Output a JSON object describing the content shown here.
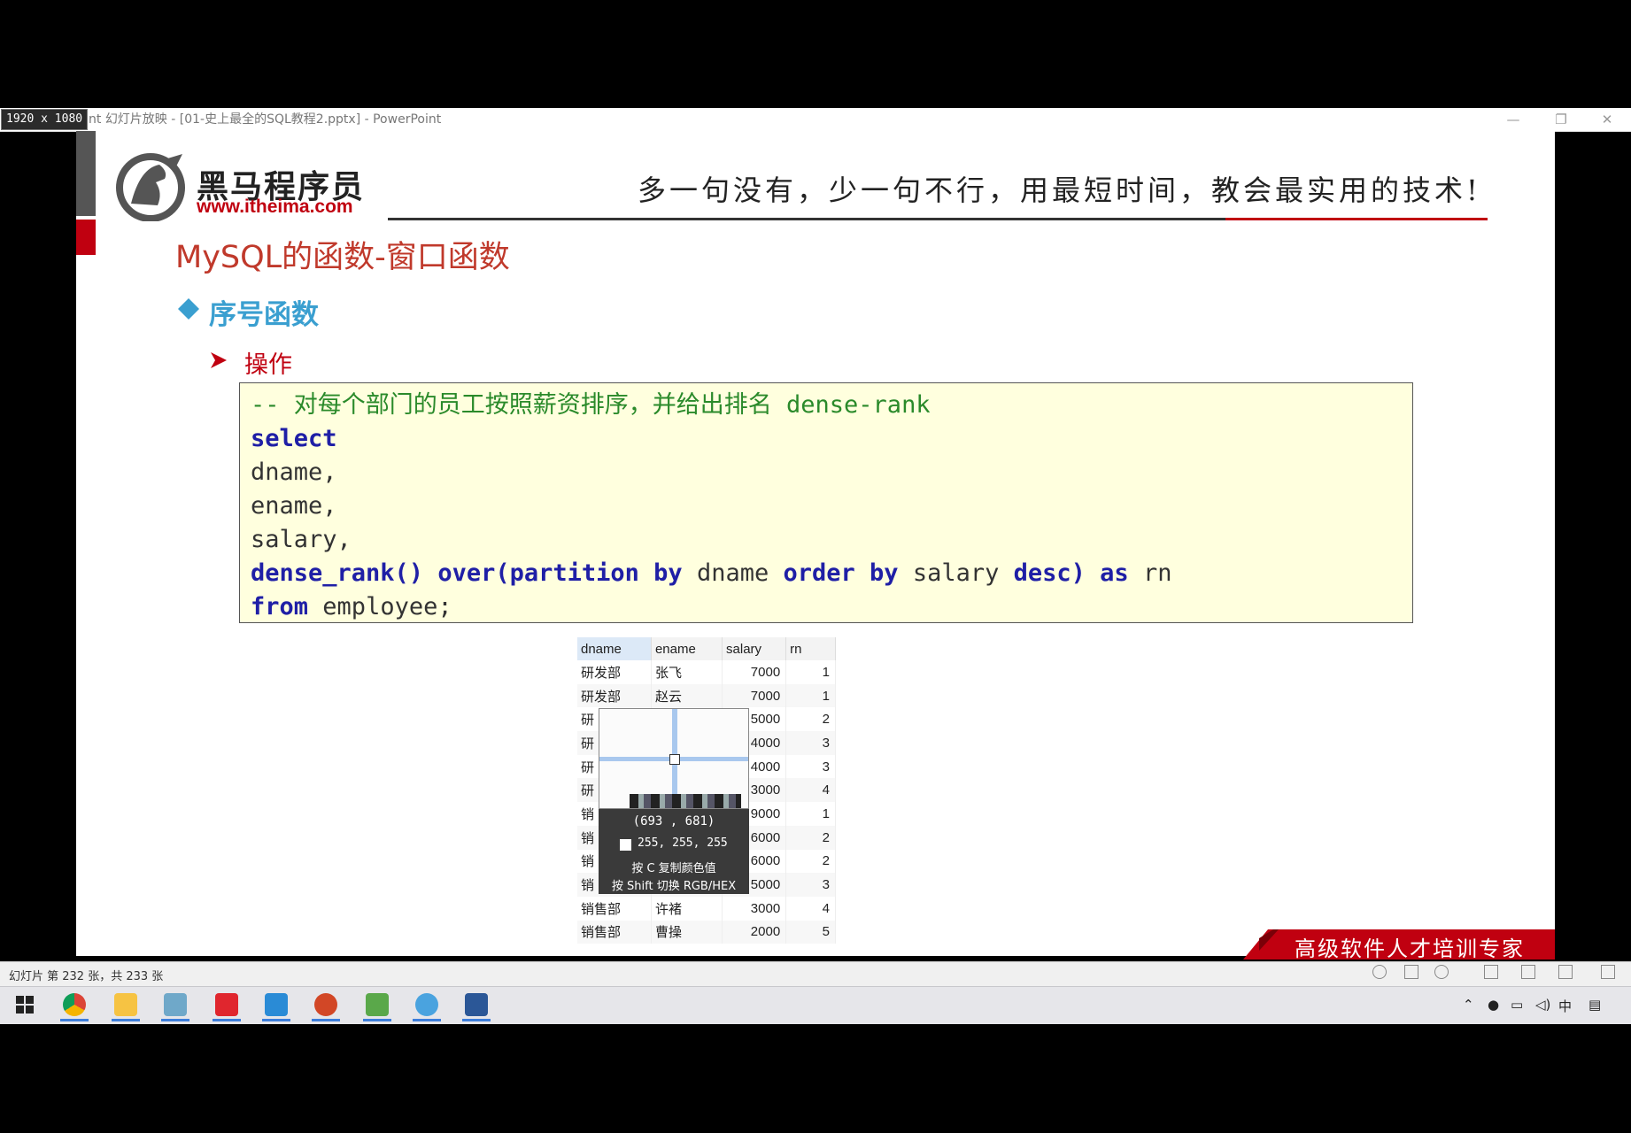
{
  "screen": {
    "dimension_badge": "1920 x 1080",
    "window_title": "nt 幻灯片放映 - [01-史上最全的SQL教程2.pptx] - PowerPoint",
    "window_controls": [
      "—",
      "❐",
      "✕"
    ]
  },
  "slide": {
    "brand_name": "黑马程序员",
    "brand_url": "www.itheima.com",
    "slogan": "多一句没有，少一句不行，用最短时间，教会最实用的技术!",
    "title": "MySQL的函数-窗口函数",
    "bullet_level1": "序号函数",
    "bullet_level2": "操作",
    "code": {
      "comment": "-- 对每个部门的员工按照薪资排序，并给出排名 dense-rank",
      "kw_select": "select",
      "line_dname": "dname,",
      "line_ename": "ename,",
      "line_salary": "salary,",
      "kw_dense_rank": "dense_rank()",
      "kw_over": "over(partition by",
      "t_dname": "dname",
      "kw_order_by": "order by",
      "t_salary": "salary",
      "kw_desc": "desc)",
      "kw_as": "as",
      "t_rn": "rn",
      "kw_from": "from",
      "t_employee": "employee;"
    },
    "result_table": {
      "columns": [
        "dname",
        "ename",
        "salary",
        "rn"
      ],
      "rows": [
        [
          "研发部",
          "张飞",
          "7000",
          "1"
        ],
        [
          "研发部",
          "赵云",
          "7000",
          "1"
        ],
        [
          "研",
          "",
          "5000",
          "2"
        ],
        [
          "研",
          "",
          "4000",
          "3"
        ],
        [
          "研",
          "",
          "4000",
          "3"
        ],
        [
          "研",
          "",
          "3000",
          "4"
        ],
        [
          "销",
          "",
          "9000",
          "1"
        ],
        [
          "销",
          "",
          "6000",
          "2"
        ],
        [
          "销",
          "",
          "6000",
          "2"
        ],
        [
          "销",
          "",
          "5000",
          "3"
        ],
        [
          "销售部",
          "许褚",
          "3000",
          "4"
        ],
        [
          "销售部",
          "曹操",
          "2000",
          "5"
        ]
      ]
    },
    "banner_text": "高级软件人才培训专家",
    "accent_red": "#c00010",
    "accent_blue": "#3a9fd0"
  },
  "color_picker": {
    "coords": "(693 , 681)",
    "rgb": "255, 255, 255",
    "hint_copy": "按 C 复制颜色值",
    "hint_switch": "按 Shift 切换 RGB/HEX"
  },
  "status_bar": {
    "slide_info": "幻灯片 第 232 张，共 233 张"
  },
  "taskbar": {
    "apps": [
      "windows-start-icon",
      "chrome-icon",
      "file-explorer-icon",
      "app-icon",
      "wps-icon",
      "remote-desktop-icon",
      "powerpoint-icon",
      "image-editor-icon",
      "browser-icon",
      "word-icon"
    ],
    "tray_ime": "中"
  }
}
